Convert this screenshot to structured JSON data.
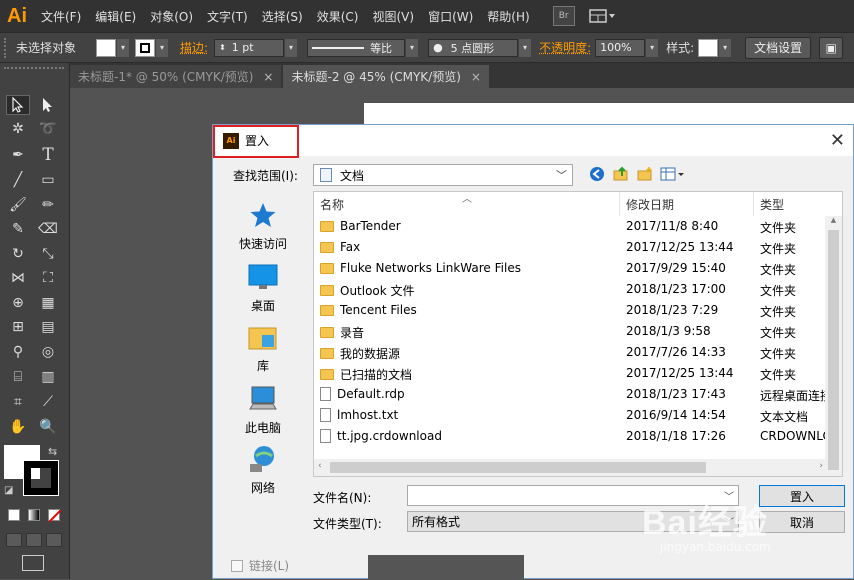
{
  "app": {
    "logo": "Ai"
  },
  "menu": [
    "文件(F)",
    "编辑(E)",
    "对象(O)",
    "文字(T)",
    "选择(S)",
    "效果(C)",
    "视图(V)",
    "窗口(W)",
    "帮助(H)"
  ],
  "menu_extra": {
    "bridge": "Br"
  },
  "control": {
    "selection": "未选择对象",
    "stroke_label": "描边:",
    "stroke_value": "1 pt",
    "stroke_profile": "等比",
    "brush_label": "5 点圆形",
    "opacity_label": "不透明度:",
    "opacity_value": "100%",
    "style_label": "样式:",
    "doc_setup": "文档设置"
  },
  "tabs": [
    {
      "label": "未标题-1* @ 50% (CMYK/预览)",
      "close": "×"
    },
    {
      "label": "未标题-2 @ 45% (CMYK/预览)",
      "close": "×"
    }
  ],
  "dialog": {
    "title_icon": "Ai",
    "title": "置入",
    "close": "✕",
    "lookin_label": "查找范围(I):",
    "lookin_value": "文档",
    "places": [
      "快速访问",
      "桌面",
      "库",
      "此电脑",
      "网络"
    ],
    "columns": {
      "name": "名称",
      "date": "修改日期",
      "type": "类型"
    },
    "files": [
      {
        "name": "BarTender",
        "date": "2017/11/8 8:40",
        "type": "文件夹",
        "kind": "folder"
      },
      {
        "name": "Fax",
        "date": "2017/12/25 13:44",
        "type": "文件夹",
        "kind": "folder"
      },
      {
        "name": "Fluke Networks LinkWare Files",
        "date": "2017/9/29 15:40",
        "type": "文件夹",
        "kind": "folder"
      },
      {
        "name": "Outlook 文件",
        "date": "2018/1/23 17:00",
        "type": "文件夹",
        "kind": "folder"
      },
      {
        "name": "Tencent Files",
        "date": "2018/1/23 7:29",
        "type": "文件夹",
        "kind": "folder"
      },
      {
        "name": "录音",
        "date": "2018/1/3 9:58",
        "type": "文件夹",
        "kind": "folder"
      },
      {
        "name": "我的数据源",
        "date": "2017/7/26 14:33",
        "type": "文件夹",
        "kind": "folder"
      },
      {
        "name": "已扫描的文档",
        "date": "2017/12/25 13:44",
        "type": "文件夹",
        "kind": "folder"
      },
      {
        "name": "Default.rdp",
        "date": "2018/1/23 17:43",
        "type": "远程桌面连接",
        "kind": "file"
      },
      {
        "name": "lmhost.txt",
        "date": "2016/9/14 14:54",
        "type": "文本文档",
        "kind": "file"
      },
      {
        "name": "tt.jpg.crdownload",
        "date": "2018/1/18 17:26",
        "type": "CRDOWNLOAD",
        "kind": "file"
      }
    ],
    "filename_label": "文件名(N):",
    "filename_value": "",
    "filetype_label": "文件类型(T):",
    "filetype_value": "所有格式",
    "place_button": "置入",
    "cancel_button": "取消",
    "link_label": "链接(L)"
  },
  "watermark": {
    "brand": "Bai经验",
    "url": "jingyan.baidu.com"
  }
}
